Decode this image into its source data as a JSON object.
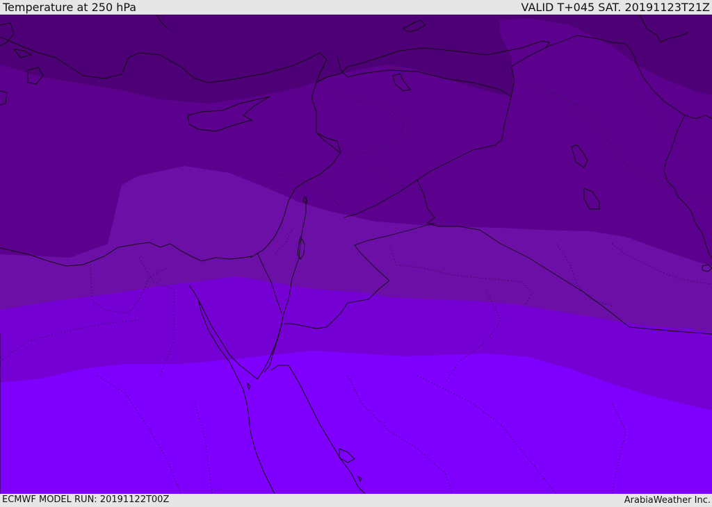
{
  "header": {
    "title": "Temperature at 250 hPa",
    "valid": "VALID T+045 SAT. 20191123T21Z"
  },
  "footer": {
    "model_run": "ECMWF MODEL RUN: 20191122T00Z",
    "credit": "ArabiaWeather Inc."
  },
  "colors": {
    "band_coldest": "#4e0077",
    "band_cold": "#5c008e",
    "band_mid": "#6b0fa6",
    "band_warm": "#7500d4",
    "band_warmest": "#7f00ff",
    "coastline": "#111111"
  }
}
